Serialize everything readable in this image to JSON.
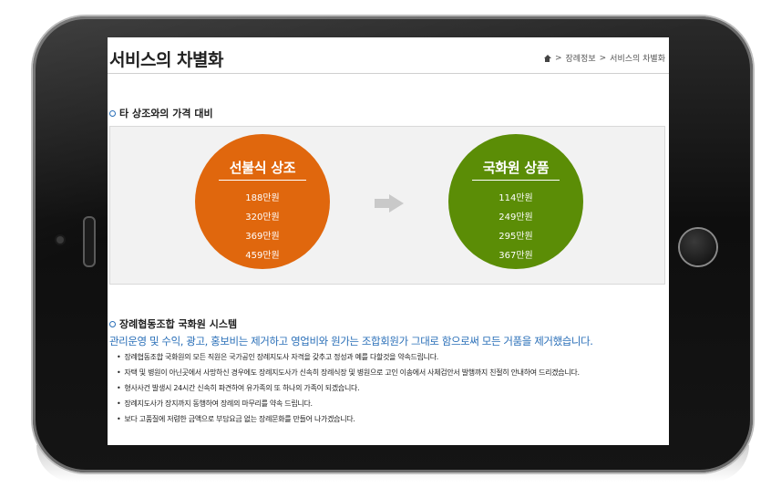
{
  "page": {
    "title": "서비스의 차별화",
    "breadcrumb": [
      "장례정보",
      "서비스의 차별화"
    ],
    "breadcrumb_sep": ">"
  },
  "price_section": {
    "heading": "타 상조와의 가격 대비",
    "left": {
      "title": "선불식 상조",
      "color": "#e0670d",
      "prices": [
        "188만원",
        "320만원",
        "369만원",
        "459만원"
      ]
    },
    "right": {
      "title": "국화원 상품",
      "color": "#5b8d06",
      "prices": [
        "114만원",
        "249만원",
        "295만원",
        "367만원"
      ]
    }
  },
  "system_section": {
    "heading": "장례협동조합 국화원 시스템",
    "lead": "관리운영 및 수익, 광고, 홍보비는 제거하고 영업비와 원가는 조합회원가 그대로 함으로써 모든 거품을 제거했습니다.",
    "items": [
      "장례협동조합 국화원의 모든 직원은 국가공인 장례지도사 자격을 갖추고 정성과 예를 다할것을 약속드립니다.",
      "자택 및 병원이 아닌곳에서 사망하신 경우에도 장례지도사가 신속히 장례식장 및 병원으로 고인 이송에서 사체검안서 발행까지 친절히 안내하여 드리겠습니다.",
      "형사사건 발생시 24시간 신속히 파견하여 유가족의 또 하나의 가족이 되겠습니다.",
      "장례지도사가 장지까지 동행하여 장례의 마무리를 약속 드립니다.",
      "보다 고품질에 저렴한 금액으로 부담요금 없는 장례문화를 만들어 나가겠습니다."
    ]
  },
  "colors": {
    "accent_blue": "#2a6fb8"
  }
}
